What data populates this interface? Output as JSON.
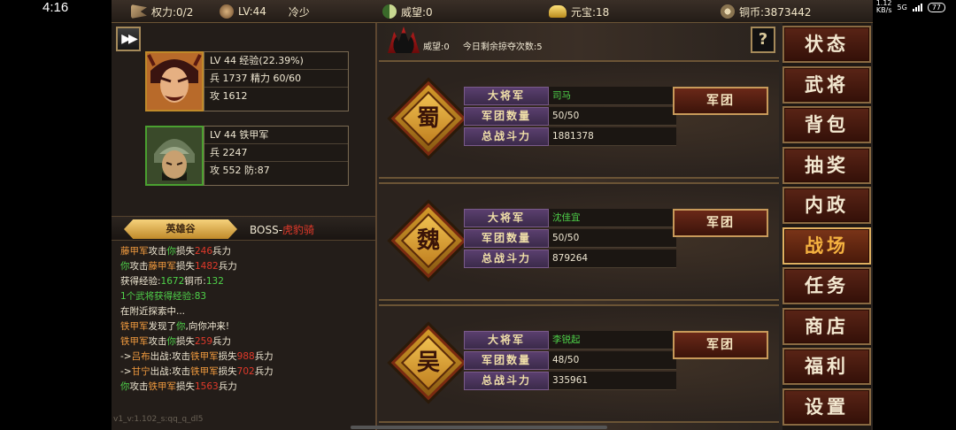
{
  "status_bar": {
    "time": "4:16",
    "net_speed": "1.12",
    "net_unit": "KB/s",
    "net_type": "5G",
    "battery": "77"
  },
  "topbar": {
    "power_label": "权力:0/2",
    "level_label": "LV:44",
    "player_name": "冷少",
    "prestige_label": "威望:0",
    "ingot_label": "元宝:18",
    "copper_label": "铜币:3873442"
  },
  "heroes": [
    {
      "line1": "LV 44  经验(22.39%)",
      "line2": "兵 1737  精力 60/60",
      "line3": "攻 1612"
    },
    {
      "line1": "LV 44   铁甲军",
      "line2": "兵 2247",
      "line3": "攻 552  防:87"
    }
  ],
  "tabs": {
    "hero_valley": "英雄谷",
    "boss_prefix": "BOSS-",
    "boss_name": "虎豹骑"
  },
  "battle_log": [
    [
      [
        "o",
        "藤甲军"
      ],
      [
        "w",
        "攻击"
      ],
      [
        "g",
        "你"
      ],
      [
        "w",
        "损失"
      ],
      [
        "r",
        "246"
      ],
      [
        "w",
        "兵力"
      ]
    ],
    [
      [
        "g",
        "你"
      ],
      [
        "w",
        "攻击"
      ],
      [
        "o",
        "藤甲军"
      ],
      [
        "w",
        "损失"
      ],
      [
        "r",
        "1482"
      ],
      [
        "w",
        "兵力"
      ]
    ],
    [
      [
        "w",
        "获得经验:"
      ],
      [
        "g",
        "1672"
      ],
      [
        "w",
        "铜币:"
      ],
      [
        "g",
        "132"
      ]
    ],
    [
      [
        "g",
        "1个武将获得经验:83"
      ]
    ],
    [
      [
        "w",
        "在附近探索中..."
      ]
    ],
    [
      [
        "o",
        "铁甲军"
      ],
      [
        "w",
        "发现了"
      ],
      [
        "g",
        "你"
      ],
      [
        "w",
        ",向你冲来!"
      ]
    ],
    [
      [
        "o",
        "铁甲军"
      ],
      [
        "w",
        "攻击"
      ],
      [
        "g",
        "你"
      ],
      [
        "w",
        "损失"
      ],
      [
        "r",
        "259"
      ],
      [
        "w",
        "兵力"
      ]
    ],
    [
      [
        "w",
        "->"
      ],
      [
        "o",
        "吕布"
      ],
      [
        "w",
        "出战:攻击"
      ],
      [
        "o",
        "铁甲军"
      ],
      [
        "w",
        "损失"
      ],
      [
        "r",
        "988"
      ],
      [
        "w",
        "兵力"
      ]
    ],
    [
      [
        "w",
        "->"
      ],
      [
        "o",
        "甘宁"
      ],
      [
        "w",
        "出战:攻击"
      ],
      [
        "o",
        "铁甲军"
      ],
      [
        "w",
        "损失"
      ],
      [
        "r",
        "702"
      ],
      [
        "w",
        "兵力"
      ]
    ],
    [
      [
        "g",
        "你"
      ],
      [
        "w",
        "攻击"
      ],
      [
        "o",
        "铁甲军"
      ],
      [
        "w",
        "损失"
      ],
      [
        "r",
        "1563"
      ],
      [
        "w",
        "兵力"
      ]
    ]
  ],
  "version": "v1_v:1.102_s:qq_q_dl5",
  "info_bar": {
    "prestige": "威望:0",
    "plunder": "今日剩余掠夺次数:5",
    "help": "?"
  },
  "labels": {
    "general": "大将军",
    "legion_count": "军团数量",
    "total_power": "总战斗力",
    "legion_button": "军团"
  },
  "kingdoms": [
    {
      "name": "蜀",
      "general": "司马",
      "legions": "50/50",
      "power": "1881378"
    },
    {
      "name": "魏",
      "general": "沈佳宜",
      "legions": "50/50",
      "power": "879264"
    },
    {
      "name": "吴",
      "general": "李锐起",
      "legions": "48/50",
      "power": "335961"
    }
  ],
  "menu": [
    {
      "label": "状态",
      "active": false
    },
    {
      "label": "武将",
      "active": false
    },
    {
      "label": "背包",
      "active": false
    },
    {
      "label": "抽奖",
      "active": false
    },
    {
      "label": "内政",
      "active": false
    },
    {
      "label": "战场",
      "active": true
    },
    {
      "label": "任务",
      "active": false
    },
    {
      "label": "商店",
      "active": false
    },
    {
      "label": "福利",
      "active": false
    },
    {
      "label": "设置",
      "active": false
    }
  ]
}
